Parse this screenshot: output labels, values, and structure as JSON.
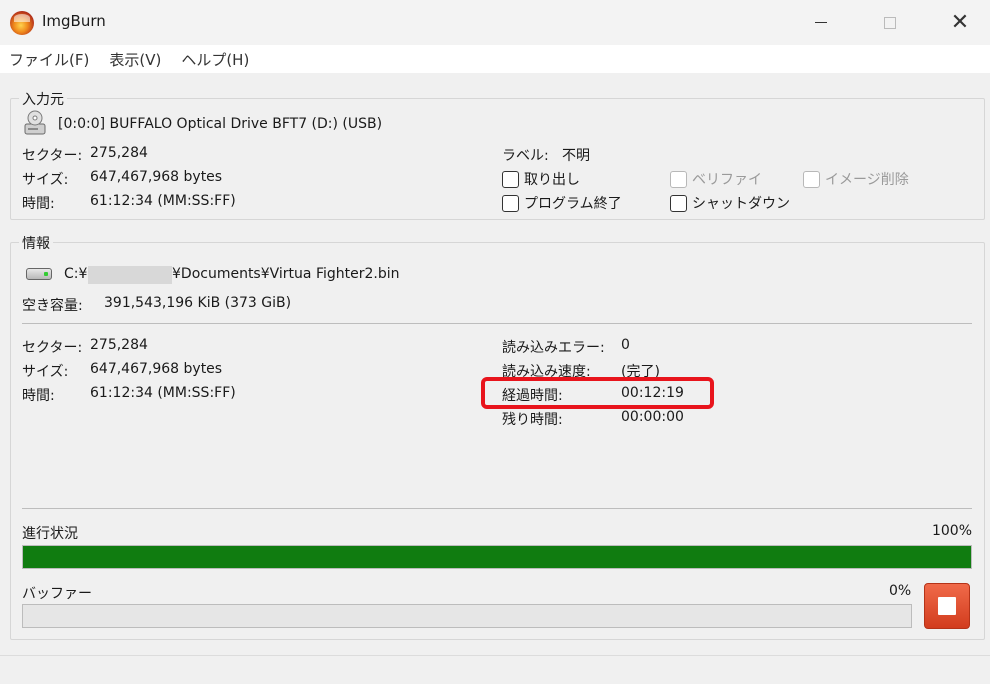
{
  "window": {
    "title": "ImgBurn"
  },
  "menu": [
    "ファイル(F)",
    "表示(V)",
    "ヘルプ(H)"
  ],
  "source": {
    "group_label": "入力元",
    "drive": "[0:0:0] BUFFALO Optical Drive BFT7 (D:) (USB)",
    "sectors_label": "セクター:",
    "sectors_value": "275,284",
    "size_label": "サイズ:",
    "size_value": "647,467,968 bytes",
    "time_label": "時間:",
    "time_value": "61:12:34 (MM:SS:FF)",
    "volume_label": "ラベル:",
    "volume_value": "不明",
    "options": {
      "eject": "取り出し",
      "verify": "ベリファイ",
      "delete_image": "イメージ削除",
      "close_program": "プログラム終了",
      "shutdown": "シャットダウン"
    }
  },
  "info": {
    "group_label": "情報",
    "path_prefix": "C:¥",
    "path_suffix": "¥Documents¥Virtua Fighter2.bin",
    "free_space_label": "空き容量:",
    "free_space_value": "391,543,196 KiB  (373 GiB)",
    "sectors_label": "セクター:",
    "sectors_value": "275,284",
    "size_label": "サイズ:",
    "size_value": "647,467,968 bytes",
    "time_label": "時間:",
    "time_value": "61:12:34 (MM:SS:FF)",
    "read_errors_label": "読み込みエラー:",
    "read_errors_value": "0",
    "read_speed_label": "読み込み速度:",
    "read_speed_value": "(完了)",
    "elapsed_label": "経過時間:",
    "elapsed_value": "00:12:19",
    "remaining_label": "残り時間:",
    "remaining_value": "00:00:00",
    "progress_label": "進行状況",
    "progress_percent": "100%",
    "progress_fraction": 1.0,
    "buffer_label": "バッファー",
    "buffer_percent": "0%",
    "buffer_fraction": 0.0
  },
  "colors": {
    "progress_fill": "#107c10",
    "highlight": "#e8141c",
    "stop_button": "#d23c1e"
  }
}
